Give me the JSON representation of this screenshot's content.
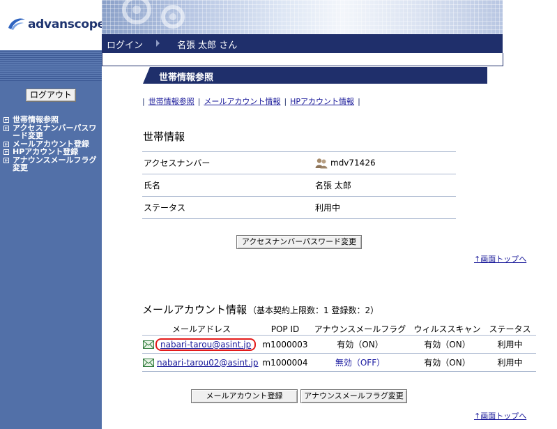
{
  "header": {
    "logo_text": "advanscope",
    "login_label": "ログイン",
    "user_name": "名張 太郎 さん"
  },
  "sidebar": {
    "logout_label": "ログアウト",
    "items": [
      {
        "label": "世帯情報参照"
      },
      {
        "label": "アクセスナンバーパスワード変更"
      },
      {
        "label": "メールアカウント登録"
      },
      {
        "label": "HPアカウント登録"
      },
      {
        "label": "アナウンスメールフラグ変更"
      }
    ]
  },
  "main": {
    "page_title": "世帯情報参照",
    "tabs": [
      {
        "label": "世帯情報参照"
      },
      {
        "label": "メールアカウント情報"
      },
      {
        "label": "HPアカウント情報"
      }
    ],
    "household": {
      "heading": "世帯情報",
      "rows": [
        {
          "label": "アクセスナンバー",
          "value": "mdv71426"
        },
        {
          "label": "氏名",
          "value": "名張 太郎"
        },
        {
          "label": "ステータス",
          "value": "利用中"
        }
      ],
      "button_label": "アクセスナンバーパスワード変更"
    },
    "to_top_label": "↑画面トップへ",
    "mail": {
      "heading": "メールアカウント情報",
      "subheading": "（基本契約上限数：1 登録数：2）",
      "columns": [
        "メールアドレス",
        "POP ID",
        "アナウンスメールフラグ",
        "ウィルススキャン",
        "ステータス"
      ],
      "rows": [
        {
          "address": "nabari-tarou@asint.jp",
          "pop_id": "m1000003",
          "announce": "有効（ON）",
          "virus": "有効（ON）",
          "status": "利用中"
        },
        {
          "address": "nabari-tarou02@asint.jp",
          "pop_id": "m1000004",
          "announce": "無効（OFF）",
          "virus": "有効（ON）",
          "status": "利用中"
        }
      ],
      "register_button": "メールアカウント登録",
      "flag_button": "アナウンスメールフラグ変更"
    }
  },
  "colors": {
    "navy": "#1f2f6b",
    "sidebar": "#5270a8",
    "link": "#1a1a9a",
    "highlight": "#e31b1b"
  }
}
